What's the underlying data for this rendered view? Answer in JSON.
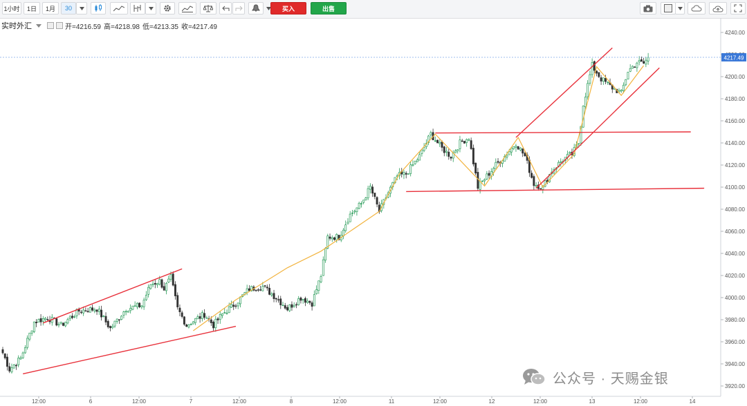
{
  "toolbar": {
    "intervals": [
      "1小时",
      "1日",
      "1月",
      "30"
    ],
    "active_interval": "30",
    "buy_label": "买入",
    "sell_label": "出售",
    "tool_icons": [
      "dropdown-icon",
      "candlestick-icon",
      "area-chart-icon",
      "line-chart-icon",
      "dropdown-icon",
      "gear-icon",
      "indicator-icon",
      "balance-icon",
      "undo-icon",
      "redo-icon",
      "alert-icon",
      "dropdown-icon"
    ],
    "right_icons": [
      "camera-icon",
      "layout-icon",
      "dropdown-icon",
      "cloud-save-icon",
      "cloud-upload-icon",
      "fullscreen-icon"
    ]
  },
  "info": {
    "symbol": "实时外汇",
    "open": "开=4216.59",
    "high": "高=4218.98",
    "low": "低=4213.35",
    "close": "收=4217.49"
  },
  "watermark": "公众号 · 天赐金银",
  "chart_data": {
    "type": "candlestick",
    "interval": "30",
    "ylim": [
      3915,
      4250
    ],
    "y_ticks": [
      3920,
      3940,
      3960,
      3980,
      4000,
      4020,
      4040,
      4060,
      4080,
      4100,
      4120,
      4140,
      4160,
      4180,
      4200,
      4220,
      4240
    ],
    "x_ticks": [
      "12:00",
      "6",
      "12:00",
      "7",
      "12:00",
      "8",
      "12:00",
      "11",
      "12:00",
      "12",
      "12:00",
      "13",
      "12:00",
      "14"
    ],
    "last_price": "4217.49",
    "grid": false,
    "colors": {
      "up": "#2a9c5a",
      "down": "#333333",
      "trend": "#e8303a",
      "zigzag": "#f2b33d",
      "last_line": "#7ea9e8",
      "tag": "#3a78d8"
    },
    "anchors": [
      {
        "i": 0,
        "p": 3950
      },
      {
        "i": 3,
        "p": 3935
      },
      {
        "i": 8,
        "p": 3945
      },
      {
        "i": 14,
        "p": 3978
      },
      {
        "i": 20,
        "p": 3982
      },
      {
        "i": 26,
        "p": 3975
      },
      {
        "i": 34,
        "p": 3988
      },
      {
        "i": 42,
        "p": 3990
      },
      {
        "i": 48,
        "p": 3972
      },
      {
        "i": 55,
        "p": 3990
      },
      {
        "i": 62,
        "p": 3993
      },
      {
        "i": 66,
        "p": 4012
      },
      {
        "i": 70,
        "p": 4015
      },
      {
        "i": 72,
        "p": 4008
      },
      {
        "i": 75,
        "p": 4018
      },
      {
        "i": 78,
        "p": 3990
      },
      {
        "i": 82,
        "p": 3975
      },
      {
        "i": 86,
        "p": 3980
      },
      {
        "i": 90,
        "p": 3985
      },
      {
        "i": 94,
        "p": 3975
      },
      {
        "i": 98,
        "p": 3985
      },
      {
        "i": 104,
        "p": 3995
      },
      {
        "i": 110,
        "p": 4008
      },
      {
        "i": 116,
        "p": 4010
      },
      {
        "i": 122,
        "p": 4000
      },
      {
        "i": 127,
        "p": 3990
      },
      {
        "i": 133,
        "p": 4000
      },
      {
        "i": 138,
        "p": 3995
      },
      {
        "i": 142,
        "p": 4020
      },
      {
        "i": 145,
        "p": 4055
      },
      {
        "i": 150,
        "p": 4055
      },
      {
        "i": 155,
        "p": 4075
      },
      {
        "i": 160,
        "p": 4085
      },
      {
        "i": 164,
        "p": 4100
      },
      {
        "i": 168,
        "p": 4078
      },
      {
        "i": 172,
        "p": 4095
      },
      {
        "i": 176,
        "p": 4110
      },
      {
        "i": 180,
        "p": 4112
      },
      {
        "i": 186,
        "p": 4128
      },
      {
        "i": 191,
        "p": 4148
      },
      {
        "i": 196,
        "p": 4135
      },
      {
        "i": 200,
        "p": 4128
      },
      {
        "i": 204,
        "p": 4140
      },
      {
        "i": 208,
        "p": 4145
      },
      {
        "i": 212,
        "p": 4100
      },
      {
        "i": 216,
        "p": 4110
      },
      {
        "i": 220,
        "p": 4120
      },
      {
        "i": 224,
        "p": 4128
      },
      {
        "i": 229,
        "p": 4140
      },
      {
        "i": 233,
        "p": 4128
      },
      {
        "i": 237,
        "p": 4103
      },
      {
        "i": 241,
        "p": 4100
      },
      {
        "i": 245,
        "p": 4115
      },
      {
        "i": 250,
        "p": 4125
      },
      {
        "i": 254,
        "p": 4130
      },
      {
        "i": 257,
        "p": 4140
      },
      {
        "i": 259,
        "p": 4175
      },
      {
        "i": 263,
        "p": 4210
      },
      {
        "i": 267,
        "p": 4198
      },
      {
        "i": 272,
        "p": 4190
      },
      {
        "i": 276,
        "p": 4185
      },
      {
        "i": 279,
        "p": 4205
      },
      {
        "i": 283,
        "p": 4213
      },
      {
        "i": 286,
        "p": 4212
      },
      {
        "i": 288,
        "p": 4217.49
      }
    ],
    "annotations": {
      "trendlines": [
        {
          "from": [
            18,
            3977
          ],
          "to": [
            80,
            4026
          ]
        },
        {
          "from": [
            9,
            3931
          ],
          "to": [
            104,
            3974
          ]
        },
        {
          "from": [
            193,
            4149
          ],
          "to": [
            307,
            4150
          ]
        },
        {
          "from": [
            180,
            4096
          ],
          "to": [
            313,
            4099
          ]
        },
        {
          "from": [
            229,
            4145
          ],
          "to": [
            272,
            4226
          ]
        },
        {
          "from": [
            238,
            4099
          ],
          "to": [
            293,
            4208
          ]
        }
      ],
      "zigzag": [
        [
          85,
          3970
        ],
        [
          104,
          3998
        ],
        [
          127,
          4027
        ],
        [
          142,
          4042
        ],
        [
          168,
          4078
        ],
        [
          177,
          4112
        ],
        [
          193,
          4148
        ],
        [
          215,
          4101
        ],
        [
          230,
          4145
        ],
        [
          241,
          4100
        ],
        [
          255,
          4130
        ],
        [
          265,
          4209
        ],
        [
          276,
          4183
        ],
        [
          286,
          4210
        ]
      ]
    }
  }
}
